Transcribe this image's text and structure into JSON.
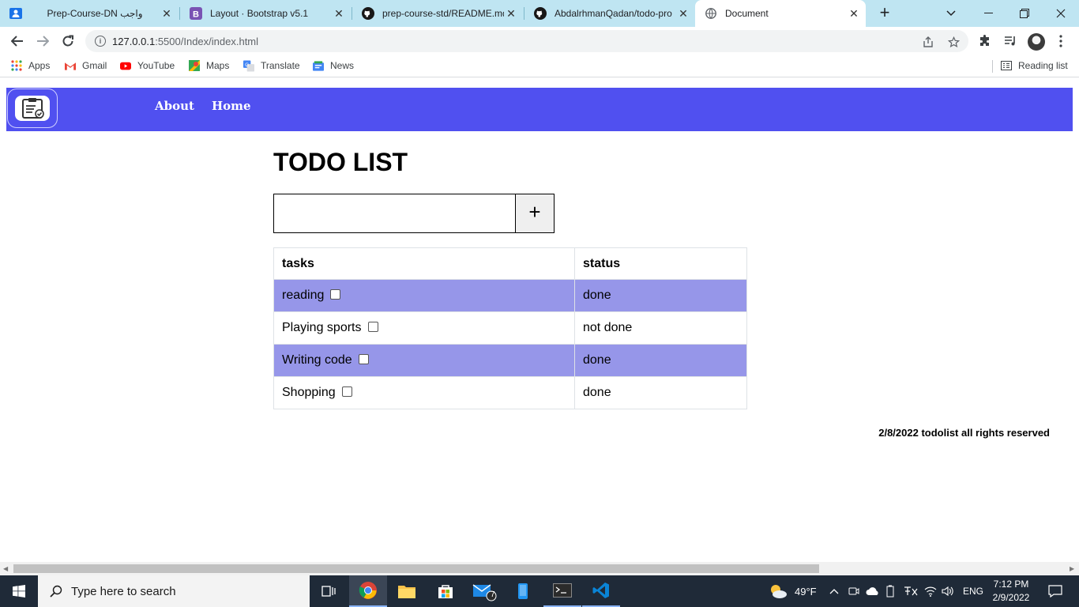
{
  "browser": {
    "tabs": [
      {
        "title": "Prep-Course-DN واجب",
        "icon": "contacts-icon"
      },
      {
        "title": "Layout · Bootstrap v5.1",
        "icon": "bootstrap-icon"
      },
      {
        "title": "prep-course-std/README.md",
        "icon": "github-icon"
      },
      {
        "title": "AbdalrhmanQadan/todo-pro",
        "icon": "github-icon"
      },
      {
        "title": "Document",
        "icon": "globe-icon",
        "active": true
      }
    ],
    "url_host": "127.0.0.1",
    "url_path": ":5500/Index/index.html",
    "bookmarks": [
      {
        "label": "Apps",
        "icon": "apps-grid-icon"
      },
      {
        "label": "Gmail",
        "icon": "gmail-icon"
      },
      {
        "label": "YouTube",
        "icon": "youtube-icon"
      },
      {
        "label": "Maps",
        "icon": "maps-icon"
      },
      {
        "label": "Translate",
        "icon": "translate-icon"
      },
      {
        "label": "News",
        "icon": "news-icon"
      }
    ],
    "reading_list": "Reading list"
  },
  "page": {
    "nav": {
      "links": [
        "About",
        "Home"
      ],
      "brand_color": "#5050f0"
    },
    "heading": "TODO LIST",
    "input": {
      "value": "",
      "placeholder": ""
    },
    "add_button": "+",
    "table": {
      "headers": [
        "tasks",
        "status"
      ],
      "rows": [
        {
          "task": "reading",
          "status": "done",
          "checked": false
        },
        {
          "task": "Playing sports",
          "status": "not done",
          "checked": false
        },
        {
          "task": "Writing code",
          "status": "done",
          "checked": false
        },
        {
          "task": "Shopping",
          "status": "done",
          "checked": false
        }
      ],
      "stripe_color": "#9696e9"
    },
    "footer": "2/8/2022 todolist all rights reserved"
  },
  "taskbar": {
    "search_placeholder": "Type here to search",
    "weather": "49°F",
    "language": "ENG",
    "time": "7:12 PM",
    "date": "2/9/2022",
    "mail_badge": "7"
  }
}
